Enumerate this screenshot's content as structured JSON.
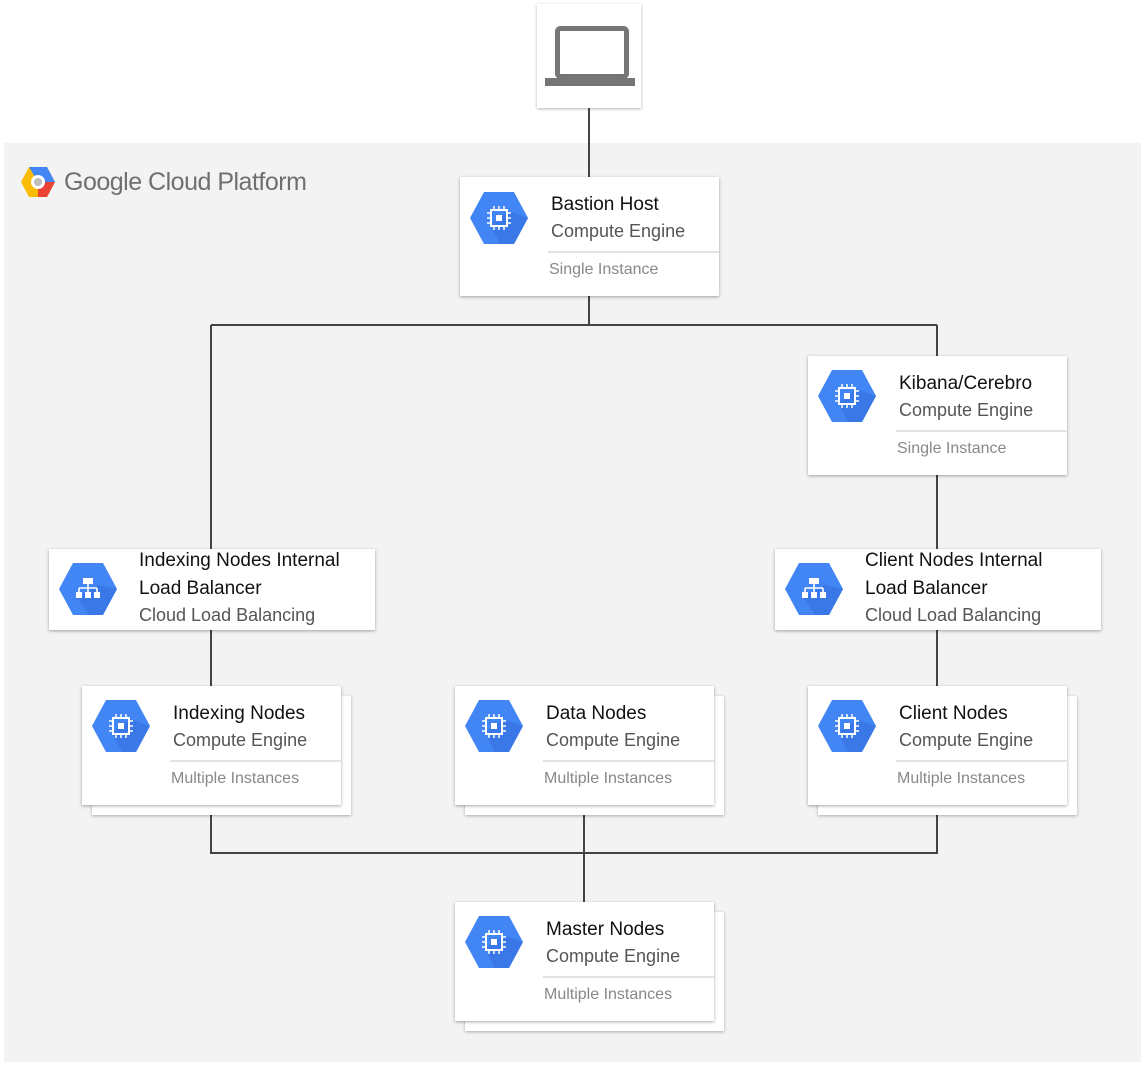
{
  "platform": {
    "name": "Google Cloud Platform",
    "logo_colors": [
      "#4285f4",
      "#ea4335",
      "#fbbc05"
    ]
  },
  "client_device": {
    "icon": "laptop-icon"
  },
  "colors": {
    "accent": "#4285f4",
    "accent_dark": "#3367d6",
    "panel": "#f3f3f3",
    "line": "#444444"
  },
  "nodes": {
    "bastion": {
      "title": "Bastion Host",
      "service": "Compute Engine",
      "instances": "Single Instance",
      "icon": "compute-engine-icon"
    },
    "kibana": {
      "title": "Kibana/Cerebro",
      "service": "Compute Engine",
      "instances": "Single Instance",
      "icon": "compute-engine-icon"
    },
    "indexing_lb": {
      "title_line1": "Indexing Nodes Internal",
      "title_line2": "Load Balancer",
      "service": "Cloud Load Balancing",
      "icon": "load-balancing-icon"
    },
    "client_lb": {
      "title_line1": "Client Nodes Internal",
      "title_line2": "Load Balancer",
      "service": "Cloud Load Balancing",
      "icon": "load-balancing-icon"
    },
    "indexing": {
      "title": "Indexing Nodes",
      "service": "Compute Engine",
      "instances": "Multiple Instances",
      "icon": "compute-engine-icon"
    },
    "data": {
      "title": "Data Nodes",
      "service": "Compute Engine",
      "instances": "Multiple Instances",
      "icon": "compute-engine-icon"
    },
    "client": {
      "title": "Client Nodes",
      "service": "Compute Engine",
      "instances": "Multiple Instances",
      "icon": "compute-engine-icon"
    },
    "master": {
      "title": "Master Nodes",
      "service": "Compute Engine",
      "instances": "Multiple Instances",
      "icon": "compute-engine-icon"
    }
  }
}
